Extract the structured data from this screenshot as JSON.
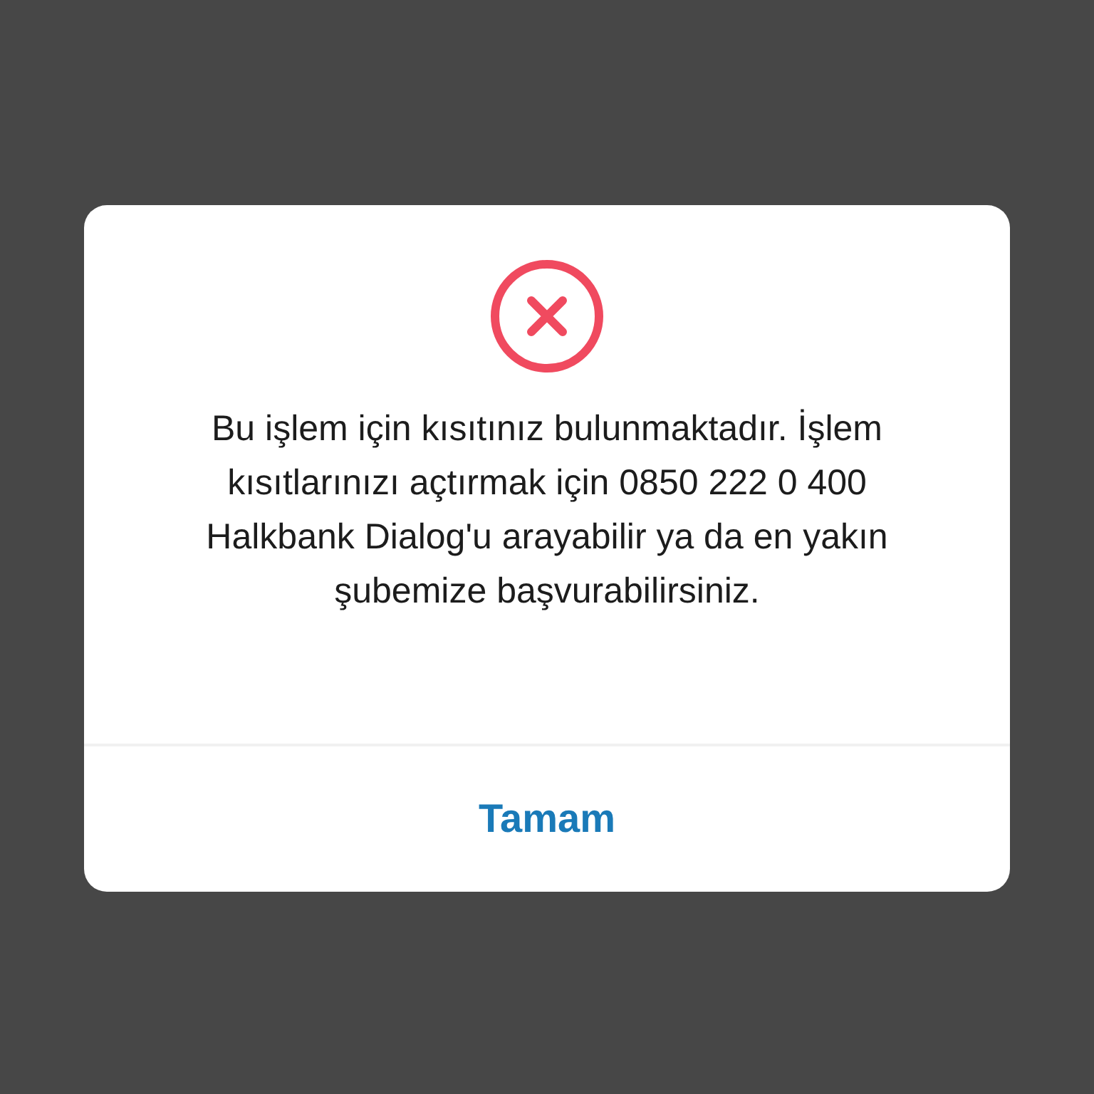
{
  "dialog": {
    "message": "Bu işlem için kısıtınız bulunmaktadır. İşlem kısıtlarınızı açtırmak için 0850 222 0 400 Halkbank Dialog'u arayabilir ya da en yakın şubemize başvurabilirsiniz.",
    "button": "Tamam"
  }
}
